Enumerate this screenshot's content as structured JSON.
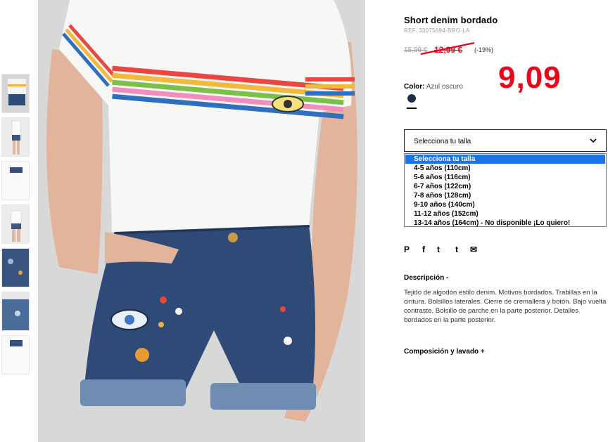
{
  "product": {
    "title": "Short denim bordado",
    "ref": "REF. 33075694-BRO-LA",
    "old_price": "15,99 €",
    "current_price": "12,99 €",
    "discount": "(-19%)",
    "handwritten_price": "9,09",
    "color_label": "Color:",
    "color_value": "Azul oscuro",
    "swatch_color": "#1e2f4e"
  },
  "size_select": {
    "label": "Selecciona tu talla",
    "options": [
      "Selecciona tu talla",
      "4-5 años (110cm)",
      "5-6 años (116cm)",
      "6-7 años (122cm)",
      "7-8 años (128cm)",
      "9-10 años (140cm)",
      "11-12 años (152cm)",
      "13-14 años (164cm) - No disponible ¡Lo quiero!"
    ],
    "selected_index": 0
  },
  "share": {
    "icons": [
      "pinterest-icon",
      "facebook-icon",
      "twitter-icon",
      "tumblr-icon",
      "email-icon"
    ],
    "glyphs": [
      "P",
      "f",
      "t",
      "t",
      "✉"
    ]
  },
  "description": {
    "heading": "Descripción -",
    "text": "Tejido de algodón estilo denim. Motivos bordados. Trabillas en la cintura. Bolsillos laterales. Cierre de cremallera y botón. Bajo vuelta contraste. Bolsillo de parche en la parte posterior. Detalles bordados en la parte posterior."
  },
  "composition": {
    "heading": "Composición y lavado +"
  },
  "colors": {
    "accent_red": "#e8081b",
    "selected_option": "#1e73e8"
  }
}
